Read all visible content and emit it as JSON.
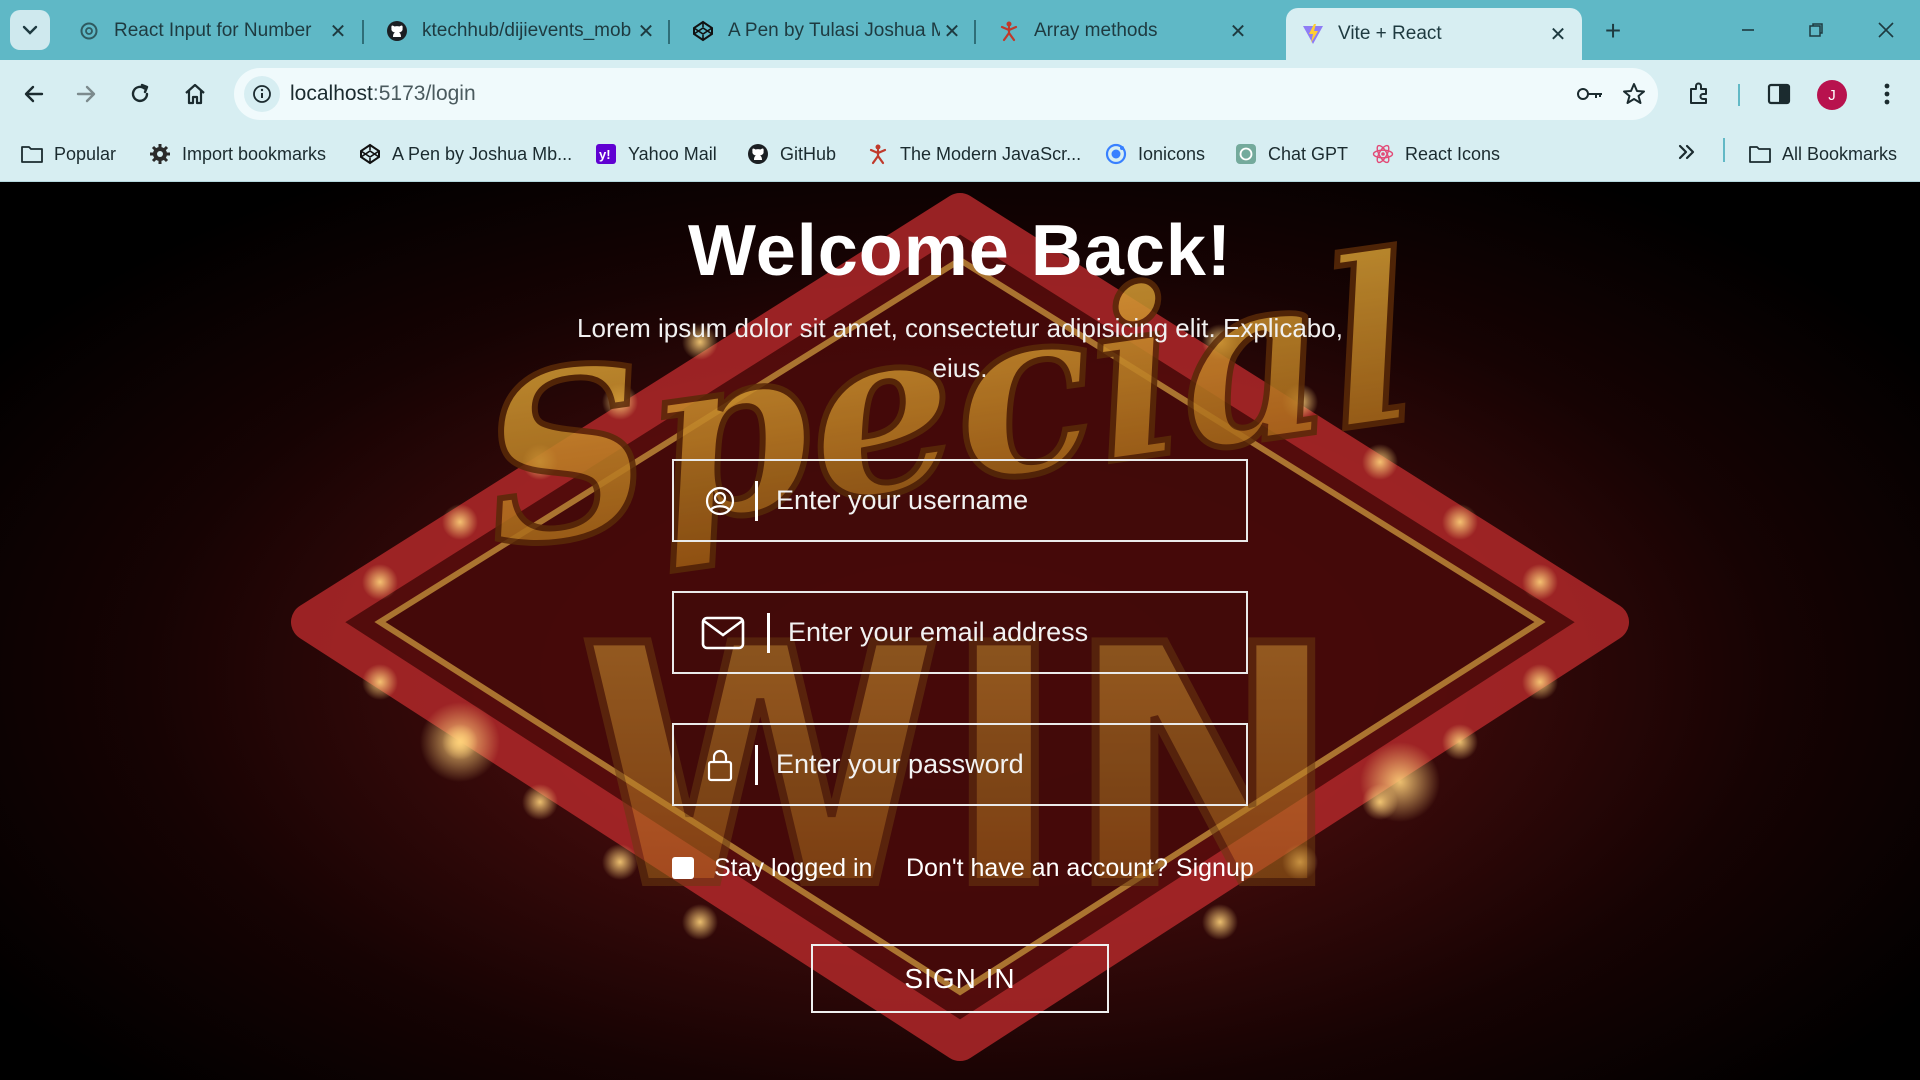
{
  "browser": {
    "tabs": [
      {
        "title": "React Input for Number",
        "icon": "openai-icon"
      },
      {
        "title": "ktechhub/dijievents_mob",
        "icon": "github-icon"
      },
      {
        "title": "A Pen by Tulasi Joshua M",
        "icon": "codepen-icon"
      },
      {
        "title": "Array methods",
        "icon": "js-figure-icon"
      },
      {
        "title": "Vite + React",
        "icon": "vite-icon"
      }
    ],
    "url_host": "localhost",
    "url_path": ":5173/login",
    "avatar_letter": "J",
    "bookmarks": [
      {
        "label": "Popular",
        "icon": "folder-icon"
      },
      {
        "label": "Import bookmarks",
        "icon": "gear-icon"
      },
      {
        "label": "A Pen by Joshua Mb...",
        "icon": "codepen-icon"
      },
      {
        "label": "Yahoo Mail",
        "icon": "yahoo-icon"
      },
      {
        "label": "GitHub",
        "icon": "github-icon"
      },
      {
        "label": "The Modern JavaScr...",
        "icon": "js-figure-icon"
      },
      {
        "label": "Ionicons",
        "icon": "ionicons-icon"
      },
      {
        "label": "Chat GPT",
        "icon": "openai-icon"
      },
      {
        "label": "React Icons",
        "icon": "react-icon"
      }
    ],
    "all_bookmarks": "All Bookmarks"
  },
  "login": {
    "title": "Welcome Back!",
    "subtitle": "Lorem ipsum dolor sit amet, consectetur adipisicing elit. Explicabo, eius.",
    "username_placeholder": "Enter your username",
    "email_placeholder": "Enter your email address",
    "password_placeholder": "Enter your password",
    "remember_label": "Stay logged in",
    "signup_prompt": "Don't have an account?",
    "signup_link": "Signup",
    "submit_label": "SIGN IN"
  },
  "background_art": {
    "word1": "Special",
    "word2": "WIN"
  },
  "colors": {
    "chrome_tab_bar": "#5fb8c6",
    "chrome_toolbar": "#d7eef2",
    "avatar": "#b8124e",
    "page_bg": "#3a0a0a",
    "text": "#ffffff"
  }
}
